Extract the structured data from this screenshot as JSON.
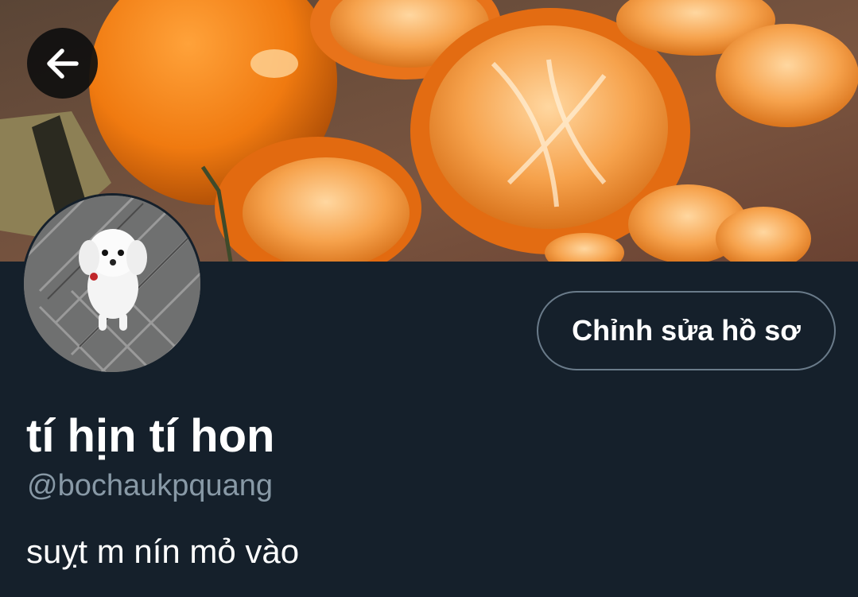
{
  "header": {
    "back_icon": "arrow-left-icon",
    "banner_image": "orange-tangerines-photo"
  },
  "profile": {
    "avatar_image": "white-dog-photo",
    "edit_button_label": "Chỉnh sửa hồ sơ",
    "display_name": "tí hịn tí hon",
    "handle": "@bochaukpquang",
    "bio": "suỵt m nín mỏ vào"
  },
  "colors": {
    "background": "#15202b",
    "secondary_text": "#8899a6",
    "button_border": "#6a7b8a",
    "primary_text": "#ffffff"
  }
}
